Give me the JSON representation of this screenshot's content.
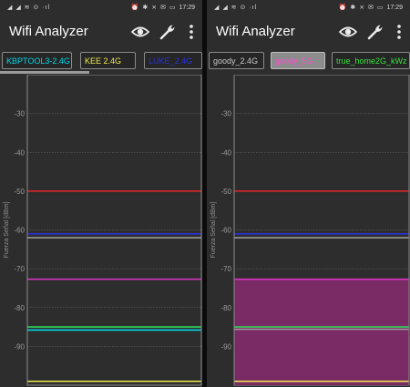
{
  "panes": [
    {
      "status_time": "17:29",
      "status_left_icons": "◢ ◢ ≋ ⊙ ·ıl",
      "status_right_icons": "⏰ ✱ ⨯ ✉ ▭",
      "app_title": "Wifi Analyzer",
      "ssid_chips": [
        {
          "label": "KBPTOOL3-2.4G",
          "color": "#00d7e8",
          "selected": false
        },
        {
          "label": "KEE 2.4G",
          "color": "#f0ea52",
          "selected": false
        },
        {
          "label": "LUKE_2.4G",
          "color": "#2a31d8",
          "selected": false
        }
      ],
      "ylabel": "Fuerza Señal [dBm]",
      "chart_data": {
        "type": "line",
        "ylabel": "Fuerza Señal [dBm]",
        "ylim": [
          -100,
          -20
        ],
        "ticks": [
          -30,
          -40,
          -50,
          -60,
          -70,
          -80,
          -90
        ],
        "grid": true,
        "series": [
          {
            "color": "#e52525",
            "values": [
              -50
            ]
          },
          {
            "color": "#2a31d8",
            "values": [
              -61
            ]
          },
          {
            "color": "#9a9a9a",
            "values": [
              -62
            ]
          },
          {
            "color": "#dd34c8",
            "values": [
              -72.7
            ]
          },
          {
            "color": "#31d65a",
            "values": [
              -85
            ]
          },
          {
            "color": "#00d7e8",
            "values": [
              -85.8
            ]
          },
          {
            "color": "#f0ea52",
            "values": [
              -99
            ]
          }
        ]
      }
    },
    {
      "status_time": "17:29",
      "status_left_icons": "◢ ◢ ≋ ⊙ ·ıl",
      "status_right_icons": "⏰ ✱ ⨯ ✉ ▭",
      "app_title": "Wifi Analyzer",
      "ssid_chips": [
        {
          "label": "goody_2.4G",
          "color": "#c9c9c9",
          "selected": false
        },
        {
          "label": "goody_5G",
          "color": "#ff4ed1",
          "selected": true
        },
        {
          "label": "true_home2G_kWz",
          "color": "#37e23f",
          "selected": false
        }
      ],
      "ylabel": "Fuerza Señal [dBm]",
      "chart_data": {
        "type": "line",
        "ylabel": "Fuerza Señal [dBm]",
        "ylim": [
          -100,
          -20
        ],
        "ticks": [
          -30,
          -40,
          -50,
          -60,
          -70,
          -80,
          -90
        ],
        "grid": true,
        "highlight_fill_top": -72.7,
        "highlight_fill_color": "#7a2b66",
        "series": [
          {
            "color": "#e52525",
            "values": [
              -50
            ]
          },
          {
            "color": "#2a31d8",
            "values": [
              -61
            ]
          },
          {
            "color": "#9a9a9a",
            "values": [
              -62
            ]
          },
          {
            "color": "#dd34c8",
            "values": [
              -72.7
            ]
          },
          {
            "color": "#31d65a",
            "values": [
              -85
            ]
          },
          {
            "color": "#9a9a9a",
            "values": [
              -85.6
            ]
          },
          {
            "color": "#f0ea52",
            "values": [
              -99
            ]
          }
        ]
      }
    }
  ]
}
